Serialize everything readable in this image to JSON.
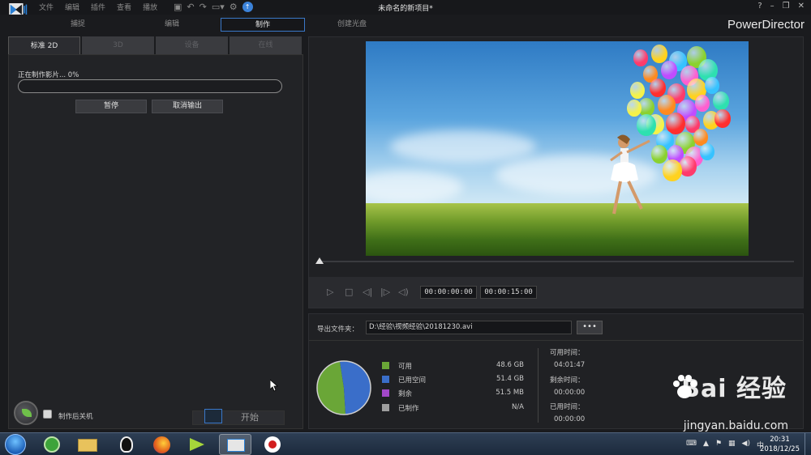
{
  "app": {
    "window_title": "未命名的新项目*",
    "brand": "PowerDirector",
    "menu": [
      "文件",
      "编辑",
      "插件",
      "查看",
      "播放"
    ]
  },
  "modes": [
    {
      "label": "捕捉",
      "active": false
    },
    {
      "label": "编辑",
      "active": false
    },
    {
      "label": "制作",
      "active": true
    },
    {
      "label": "创建光盘",
      "active": false
    }
  ],
  "produce": {
    "tabs": [
      {
        "label": "标准 2D",
        "active": true
      },
      {
        "label": "3D",
        "active": false
      },
      {
        "label": "设备",
        "active": false
      },
      {
        "label": "在线",
        "active": false
      }
    ],
    "progress_label": "正在制作影片... 0%",
    "progress_fraction": 0,
    "pause_label": "暂停",
    "cancel_label": "取消输出",
    "shutdown_label": "制作后关机",
    "shutdown_checked": false,
    "start_label": "开始"
  },
  "preview": {
    "timecode_current": "00:00:00:00",
    "timecode_total": "00:00:15:00"
  },
  "output": {
    "folder_label": "导出文件夹：",
    "folder_path": "D:\\经验\\视频经验\\20181230.avi",
    "browse_label": "•••",
    "legend": [
      {
        "label": "可用",
        "value": "48.6  GB",
        "color": "#6aa637"
      },
      {
        "label": "已用空间",
        "value": "51.4  GB",
        "color": "#3a6ec9"
      },
      {
        "label": "剩余",
        "value": "51.5  MB",
        "color": "#a348c9"
      },
      {
        "label": "已制作",
        "value": "N/A",
        "color": "#9e9e9e"
      }
    ],
    "disk_chart": {
      "type": "pie",
      "values": [
        48.6,
        51.4
      ],
      "colors": [
        "#6aa637",
        "#3a6ec9"
      ]
    },
    "available_time_label": "可用时间：",
    "available_time": "04:01:47",
    "remaining_time_label": "剩余时间：",
    "remaining_time": "00:00:00",
    "elapsed_time_label": "已用时间：",
    "elapsed_time": "00:00:00"
  },
  "taskbar": {
    "clock_time": "20:31",
    "clock_date": "2018/12/25"
  },
  "watermark": {
    "logo_text": "Bai  经验",
    "url": "jingyan.baidu.com"
  }
}
